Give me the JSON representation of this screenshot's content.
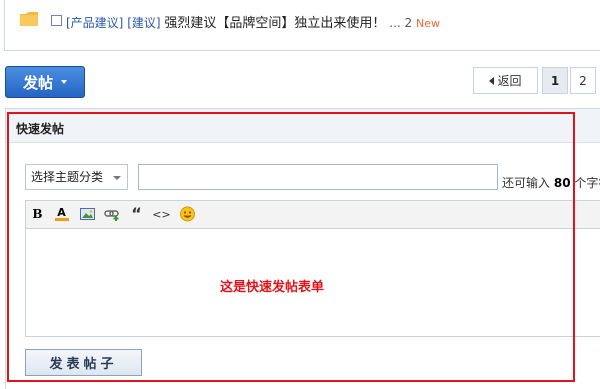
{
  "thread": {
    "category": "[产品建议]",
    "tag": "[建议]",
    "title": "强烈建议【品牌空间】独立出来使用！",
    "pages": "... 2",
    "new_badge": "New",
    "icon": "folder-icon"
  },
  "actions": {
    "post_button": "发帖"
  },
  "pager": {
    "back_label": "返回",
    "pages": [
      "1",
      "2"
    ],
    "current": "1"
  },
  "quick_post": {
    "title": "快速发帖",
    "type_select": "选择主题分类",
    "subject_value": "",
    "remain_prefix": "还可输入",
    "remain_count": "80",
    "remain_suffix": "个字符",
    "toolbar": [
      "bold-icon",
      "font-color-icon",
      "image-icon",
      "link-icon",
      "quote-icon",
      "code-icon",
      "smiley-icon"
    ],
    "toolbar_labels": {
      "bold": "B",
      "font_color": "A",
      "quote": "“",
      "code": "<>"
    },
    "editor_hint": "这是快速发帖表单",
    "submit": "发表帖子"
  },
  "colors": {
    "accent_blue": "#2565c3",
    "highlight_red": "#e0151c",
    "new_orange": "#e86c33"
  }
}
